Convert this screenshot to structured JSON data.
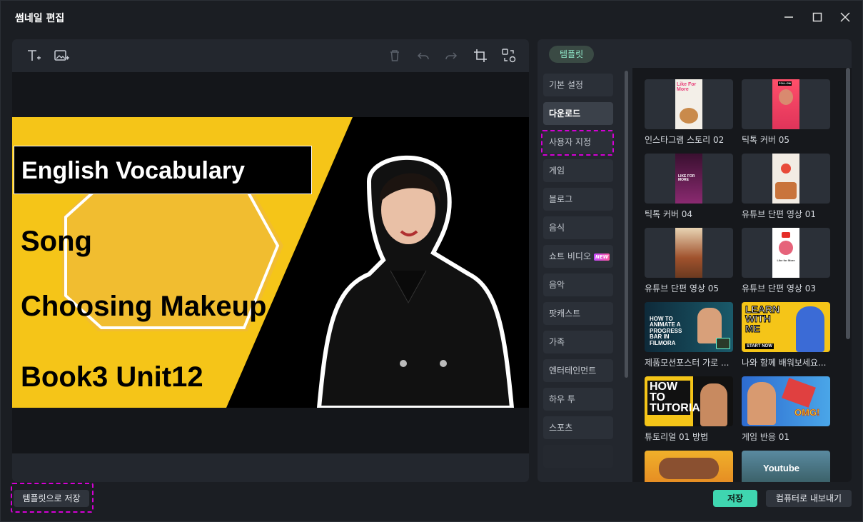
{
  "window": {
    "title": "썸네일 편집"
  },
  "toolbar": {
    "icons": [
      "text-icon",
      "image-icon",
      "trash-icon",
      "undo-icon",
      "redo-icon",
      "crop-icon",
      "replace-icon"
    ]
  },
  "canvas": {
    "title": "English Vocabulary",
    "line1": "Song",
    "line2": "Choosing Makeup",
    "line3": "Book3 Unit12",
    "accent": "#f5c518"
  },
  "panel": {
    "tab": "템플릿",
    "categories": [
      "기본 설정",
      "다운로드",
      "사용자 지정",
      "게임",
      "블로그",
      "음식",
      "쇼트 비디오",
      "음악",
      "팟캐스트",
      "가족",
      "엔터테인먼트",
      "하우 투",
      "스포츠"
    ],
    "active_category": "다운로드",
    "new_badge": "NEW",
    "templates": [
      {
        "label": "인스타그램 스토리 02",
        "thumb_text": "Like For More"
      },
      {
        "label": "틱톡 커버 05",
        "thumb_text": "FOLLOW"
      },
      {
        "label": "틱톡 커버 04",
        "thumb_text": "LIKE FOR MORE"
      },
      {
        "label": "유튜브 단편 영상 01",
        "thumb_text": ""
      },
      {
        "label": "유튜브 단편 영상 05",
        "thumb_text": ""
      },
      {
        "label": "유튜브 단편 영상 03",
        "thumb_text": "Like for More"
      },
      {
        "label": "제품모션포스터 가로 ...",
        "thumb_text": "HOW TO ANIMATE A PROGRESS BAR IN FILMORA"
      },
      {
        "label": "나와 함께 배워보세요...",
        "thumb_text": "LEARN WITH ME",
        "thumb_sub": "START NOW"
      },
      {
        "label": "튜토리얼 01 방법",
        "thumb_text": "HOW TO TUTORIAL"
      },
      {
        "label": "게임 반응 01",
        "thumb_text": "OMG!"
      },
      {
        "label": "",
        "thumb_text": ""
      },
      {
        "label": "",
        "thumb_text": "Youtube"
      }
    ]
  },
  "footer": {
    "save_template": "템플릿으로 저장",
    "save": "저장",
    "export": "컴퓨터로 내보내기"
  },
  "colors": {
    "accent": "#3fd6b0",
    "highlight": "#d400d4"
  }
}
